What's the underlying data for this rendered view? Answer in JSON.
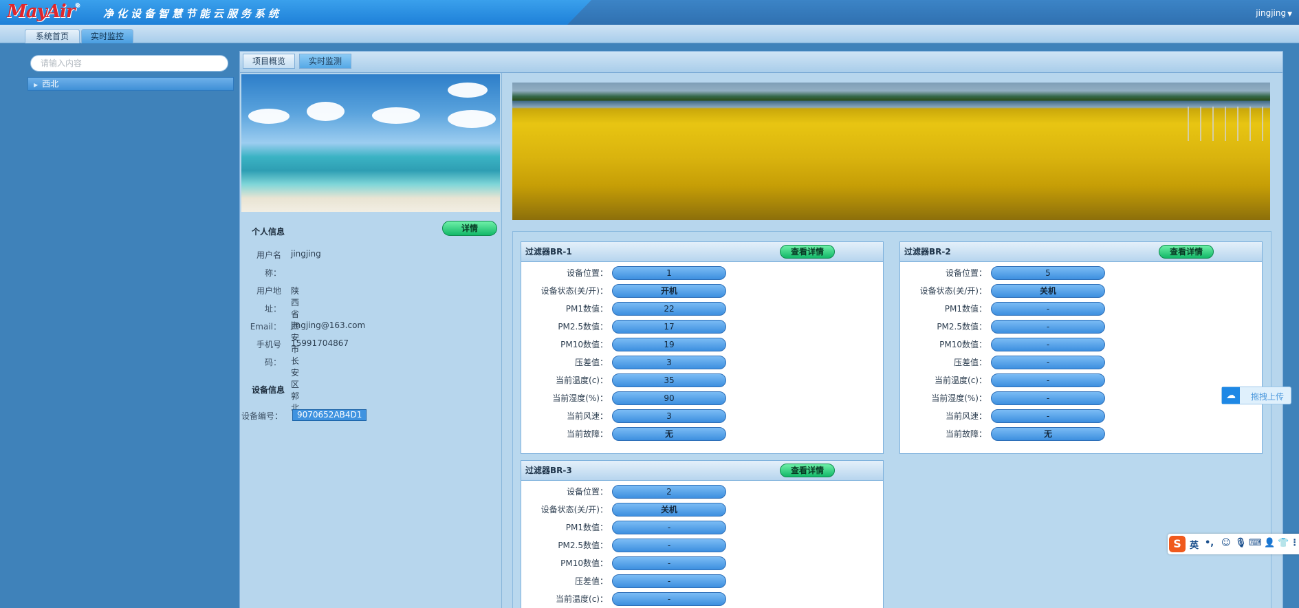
{
  "app": {
    "logo_text": "MayAir",
    "system_title": "净化设备智慧节能云服务系统",
    "user": "jingjing"
  },
  "nav": {
    "tabs": [
      {
        "label": "系统首页"
      },
      {
        "label": "实时监控"
      }
    ]
  },
  "sidebar": {
    "search_placeholder": "请输入内容",
    "items": [
      {
        "label": "西北"
      }
    ]
  },
  "subtabs": [
    {
      "label": "项目概览"
    },
    {
      "label": "实时监测"
    }
  ],
  "personal_info": {
    "heading": "个人信息",
    "detail_button": "详情",
    "username_label_1": "用户名",
    "username_label_2": "称：",
    "username": "jingjing",
    "address_label_1": "用户地",
    "address_label_2": "址：",
    "address": "陕西省西安市长安区郭北",
    "email_label": "Email：",
    "email": "jingjing@163.com",
    "phone_label_1": "手机号",
    "phone_label_2": "码：",
    "phone": "15991704867"
  },
  "device_info": {
    "heading": "设备信息",
    "code_label": "设备编号：",
    "code": "9070652AB4D1"
  },
  "filter_labels": {
    "position": "设备位置：",
    "status": "设备状态(关/开)：",
    "pm1": "PM1数值：",
    "pm25": "PM2.5数值：",
    "pm10": "PM10数值：",
    "pressure": "压差值：",
    "temp": "当前温度(c)：",
    "humidity": "当前湿度(%)：",
    "wind": "当前风速：",
    "fault": "当前故障："
  },
  "filters": [
    {
      "title": "过滤器BR-1",
      "button": "查看详情",
      "values": {
        "position": "1",
        "status": "开机",
        "pm1": "22",
        "pm25": "17",
        "pm10": "19",
        "pressure": "3",
        "temp": "35",
        "humidity": "90",
        "wind": "3",
        "fault": "无"
      }
    },
    {
      "title": "过滤器BR-2",
      "button": "查看详情",
      "values": {
        "position": "5",
        "status": "关机",
        "pm1": "-",
        "pm25": "-",
        "pm10": "-",
        "pressure": "-",
        "temp": "-",
        "humidity": "-",
        "wind": "-",
        "fault": "无"
      }
    },
    {
      "title": "过滤器BR-3",
      "button": "查看详情",
      "values": {
        "position": "2",
        "status": "关机",
        "pm1": "-",
        "pm25": "-",
        "pm10": "-",
        "pressure": "-",
        "temp": "-"
      }
    }
  ],
  "widgets": {
    "upload_label": "拖拽上传",
    "ime_lang": "英",
    "ime_logo": "S",
    "ime_punct": "•,"
  },
  "icons": {
    "upload": "cloud-upload-icon",
    "ime": [
      "emoji-icon",
      "microphone-icon",
      "keyboard-icon",
      "user-icon",
      "shirt-icon"
    ]
  }
}
